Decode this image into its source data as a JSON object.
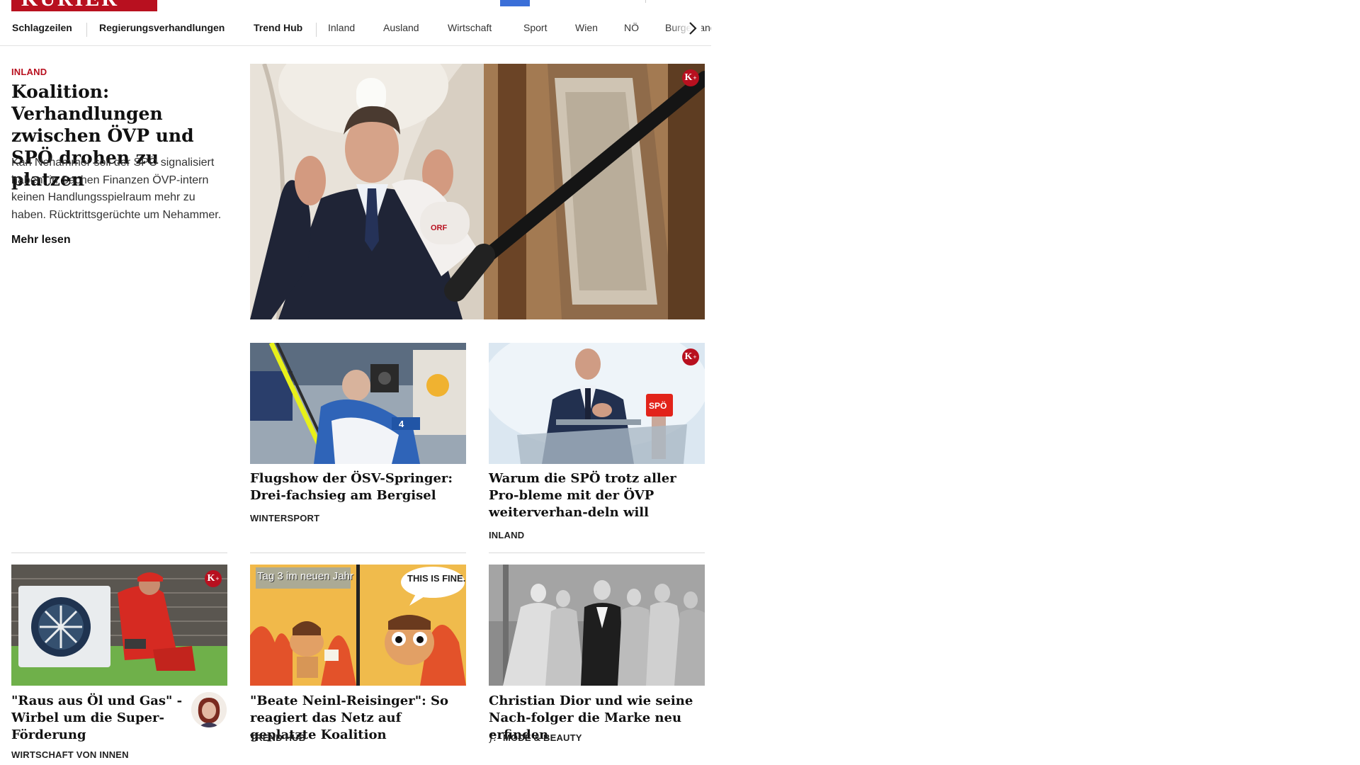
{
  "brand": {
    "logo_text": "KURIER",
    "color": "#b8101f"
  },
  "nav": {
    "items": [
      {
        "label": "Schlagzeilen",
        "bold": true
      },
      {
        "label": "Regierungsverhandlungen",
        "bold": true
      },
      {
        "label": "Trend Hub",
        "bold": true
      },
      {
        "label": "Inland",
        "bold": false
      },
      {
        "label": "Ausland",
        "bold": false
      },
      {
        "label": "Wirtschaft",
        "bold": false
      },
      {
        "label": "Sport",
        "bold": false
      },
      {
        "label": "Wien",
        "bold": false
      },
      {
        "label": "NÖ",
        "bold": false
      },
      {
        "label": "Burgenland",
        "bold": false
      }
    ],
    "next_icon": "chevron-right-icon"
  },
  "lead": {
    "kicker": "Inland",
    "title": "Koalition: Verhandlungen zwischen ÖVP und SPÖ drohen zu platzen",
    "teaser": "Karl Nehammer soll der SPÖ signalisiert haben, in Sachen Finanzen ÖVP-intern keinen Handlungsspielraum mehr zu haben. Rücktrittsgerüchte um Nehammer.",
    "more_label": "Mehr lesen",
    "premium": true
  },
  "cards": [
    {
      "title": "Flugshow der ÖSV-Springer: Drei-fachsieg am Bergisel",
      "category": "Wintersport",
      "premium": false
    },
    {
      "title": "Warum die SPÖ trotz aller Pro-bleme mit der ÖVP weiterverhan-deln will",
      "category": "Inland",
      "premium": true
    },
    {
      "title": "\"Raus aus Öl und Gas\" - Wirbel um die Super-Förderung",
      "category": "Wirtschaft von innen",
      "premium": true
    },
    {
      "title": "\"Beate Neinl-Reisinger\": So reagiert das Netz auf geplatzte Koalition",
      "category": "Trend Hub",
      "premium": false
    },
    {
      "title": "Christian Dior und wie seine Nach-folger die Marke neu erfinden",
      "category": "Mode & Beauty",
      "premium": false
    }
  ],
  "meme": {
    "left_caption": "Tag 3 im neuen Jahr",
    "right_caption": "THIS IS FINE."
  },
  "premium_badge": {
    "letter": "K",
    "sup": "+"
  }
}
